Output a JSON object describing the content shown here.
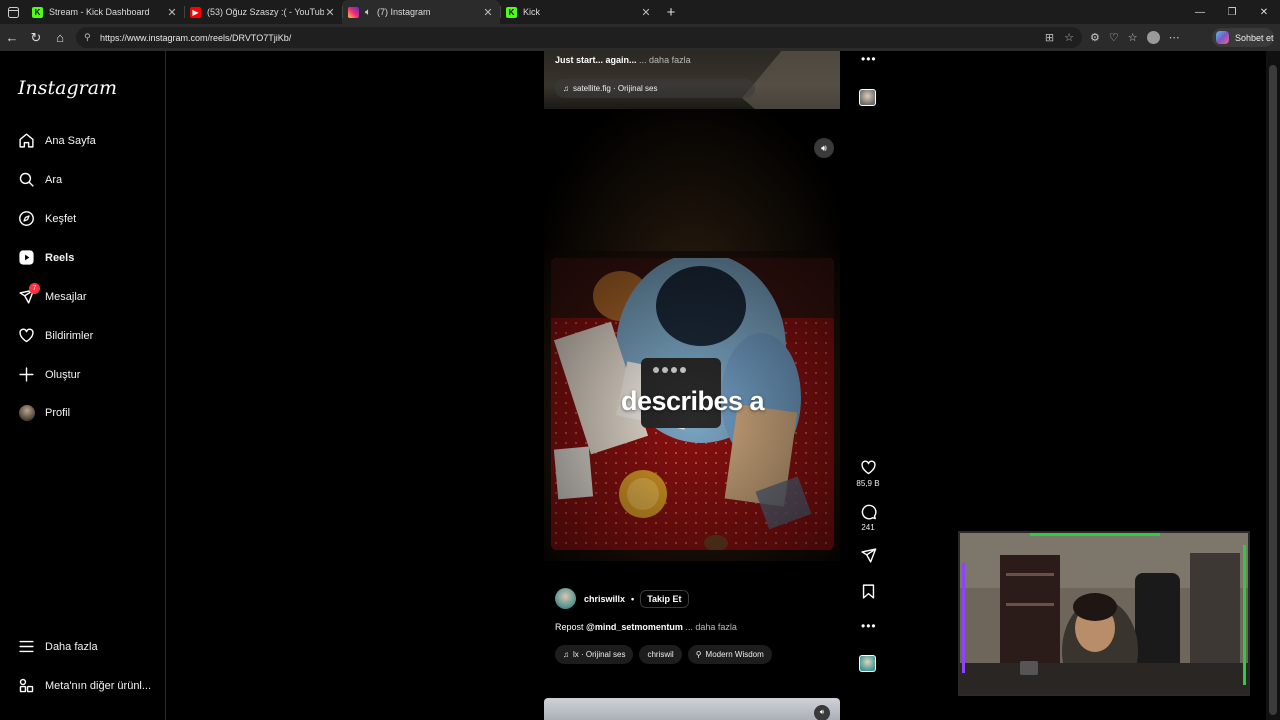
{
  "browser": {
    "tabs": [
      {
        "title": "Stream - Kick Dashboard",
        "favicon": "kick-icon",
        "color": "#53fc18",
        "active": false
      },
      {
        "title": "(53) Oğuz Szaszy :( - YouTube",
        "favicon": "youtube-icon",
        "color": "#ff0000",
        "active": false
      },
      {
        "title": "(7) Instagram",
        "favicon": "instagram-icon",
        "color": "#e1306c",
        "active": true,
        "playing_audio": true
      },
      {
        "title": "Kick",
        "favicon": "kick-icon",
        "color": "#53fc18",
        "active": false
      }
    ],
    "url": "https://www.instagram.com/reels/DRVTO7TjiKb/",
    "copilot_label": "Sohbet et"
  },
  "sidebar": {
    "logo": "Instagram",
    "items": [
      {
        "label": "Ana Sayfa",
        "icon": "home-icon"
      },
      {
        "label": "Ara",
        "icon": "search-icon"
      },
      {
        "label": "Keşfet",
        "icon": "compass-icon"
      },
      {
        "label": "Reels",
        "icon": "reels-icon",
        "active": true
      },
      {
        "label": "Mesajlar",
        "icon": "messenger-icon",
        "badge": "7"
      },
      {
        "label": "Bildirimler",
        "icon": "heart-icon"
      },
      {
        "label": "Oluştur",
        "icon": "plus-icon"
      },
      {
        "label": "Profil",
        "icon": "avatar"
      }
    ],
    "more": "Daha fazla",
    "meta": "Meta'nın diğer ürünl..."
  },
  "reel_prev": {
    "caption": "Just start... again...",
    "more": "... daha fazla",
    "audio": "satellite.fig · Orijinal ses"
  },
  "reel_main": {
    "overlay_text": "describes a",
    "likes": "85,9 B",
    "comments": "241",
    "author": "chriswillx",
    "follow": "Takip Et",
    "caption_prefix": "Repost",
    "caption_mention": "@mind_setmomentum",
    "more": "... daha fazla",
    "audio": "lx · Orijinal ses",
    "tag_user": "chriswil",
    "location": "Modern Wisdom"
  },
  "colors": {
    "badge": "#ff3040",
    "background": "#000000",
    "webcam_green": "#2ecc40",
    "webcam_purple": "#8e44ff"
  }
}
